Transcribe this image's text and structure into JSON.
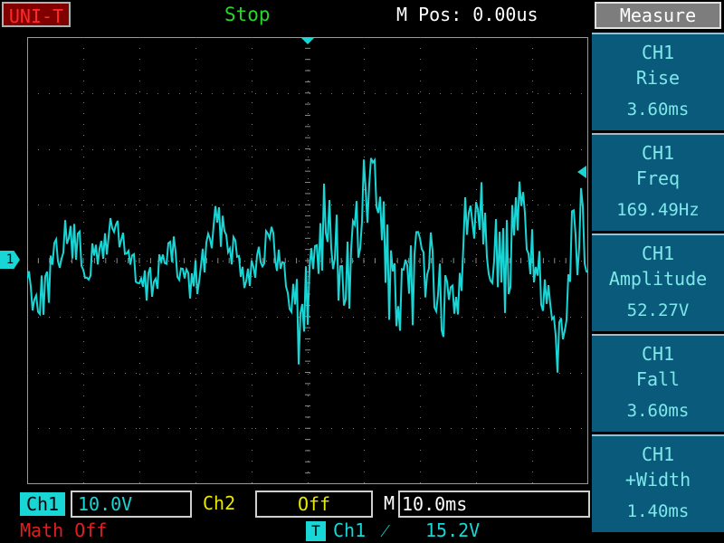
{
  "topbar": {
    "brand": "UNI-T",
    "status": "Stop",
    "mpos": "M Pos: 0.00us"
  },
  "screen": {
    "channel_marker": "1",
    "trace_color": "#18d6d6"
  },
  "panel": {
    "title": "Measure",
    "items": [
      {
        "ch": "CH1",
        "name": "Rise",
        "value": "3.60ms"
      },
      {
        "ch": "CH1",
        "name": "Freq",
        "value": "169.49Hz"
      },
      {
        "ch": "CH1",
        "name": "Amplitude",
        "value": "52.27V"
      },
      {
        "ch": "CH1",
        "name": "Fall",
        "value": "3.60ms"
      },
      {
        "ch": "CH1",
        "name": "+Width",
        "value": "1.40ms"
      }
    ]
  },
  "bottom": {
    "ch1_label": "Ch1",
    "ch1_value": "10.0V",
    "ch2_label": "Ch2",
    "ch2_value": "Off",
    "m_label": "M",
    "m_value": "10.0ms",
    "math": "Math Off",
    "trigger_icon": "T",
    "trigger_source": "Ch1",
    "trigger_edge": "⁄",
    "trigger_level": "15.2V"
  }
}
